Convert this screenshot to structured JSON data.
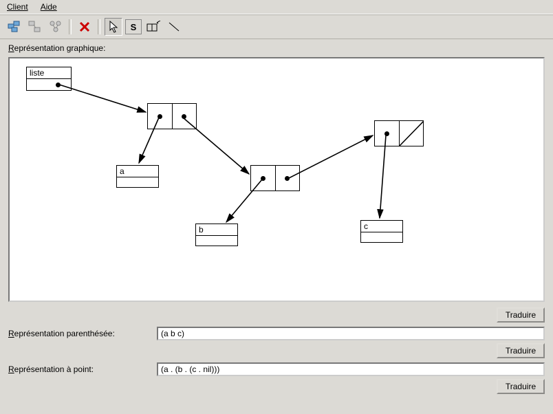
{
  "menu": {
    "client": "Client",
    "aide": "Aide"
  },
  "labels": {
    "graph_section": "Représentation graphique:",
    "paren_section": "Représentation parenthésée:",
    "point_section": "Représentation à point:",
    "translate": "Traduire"
  },
  "fields": {
    "paren_value": "(a b c)",
    "point_value": "(a . (b . (c . nil)))"
  },
  "diagram": {
    "root_label": "liste",
    "atoms": {
      "a": "a",
      "b": "b",
      "c": "c"
    }
  },
  "icons": {
    "clients": "clients-icon",
    "unlink": "unlink-icon",
    "tree": "tree-icon",
    "delete": "delete-icon",
    "pointer": "pointer-icon",
    "s": "S",
    "newbox": "newbox-icon",
    "line": "line-icon"
  }
}
